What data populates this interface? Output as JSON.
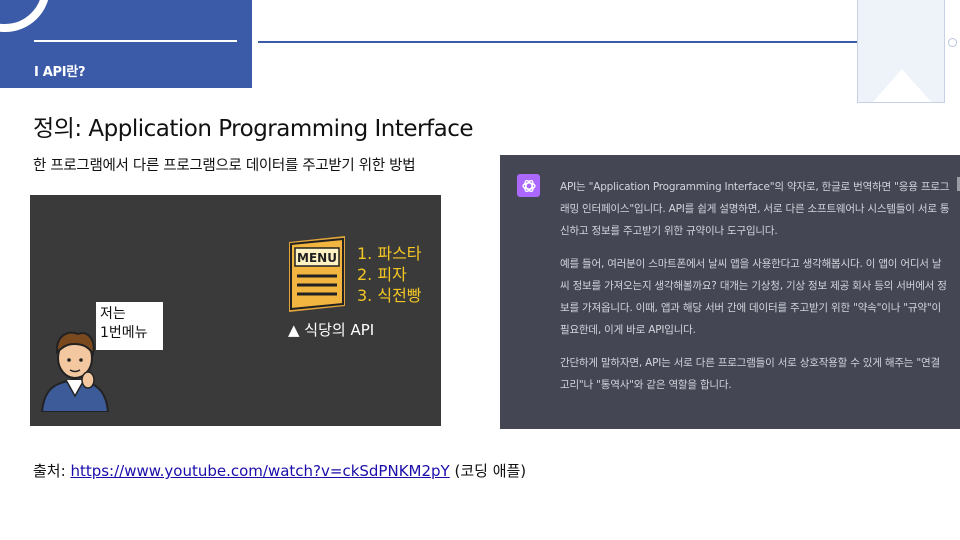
{
  "header": {
    "section_label": "I API란?"
  },
  "slide": {
    "title": "정의: Application Programming Interface",
    "subtitle": "한 프로그램에서 다른 프로그램으로 데이터를 주고받기 위한 방법"
  },
  "illustration": {
    "menu_sign": "MENU",
    "menu_items": [
      "1. 파스타",
      "2. 피자",
      "3. 식전빵"
    ],
    "caption": "▲ 식당의 API",
    "speech_lines": [
      "저는",
      "1번메뉴"
    ]
  },
  "chat": {
    "avatar_icon": "openai-logo-icon",
    "paragraphs": [
      "API는 \"Application Programming Interface\"의 약자로, 한글로 번역하면 \"응용 프로그래밍 인터페이스\"입니다. API를 쉽게 설명하면, 서로 다른 소프트웨어나 시스템들이 서로 통신하고 정보를 주고받기 위한 규약이나 도구입니다.",
      "예를 들어, 여러분이 스마트폰에서 날씨 앱을 사용한다고 생각해봅시다. 이 앱이 어디서 날씨 정보를 가져오는지 생각해볼까요? 대개는 기상청, 기상 정보 제공 회사 등의 서버에서 정보를 가져옵니다. 이때, 앱과 해당 서버 간에 데이터를 주고받기 위한 \"약속\"이나 \"규약\"이 필요한데, 이게 바로 API입니다.",
      "간단하게 말하자면, API는 서로 다른 프로그램들이 서로 상호작용할 수 있게 해주는 \"연결 고리\"나 \"통역사\"와 같은 역할을 합니다."
    ]
  },
  "source": {
    "label": "출처: ",
    "url": "https://www.youtube.com/watch?v=ckSdPNKM2pY",
    "suffix": " (코딩 애플)"
  },
  "colors": {
    "accent": "#3b5ba9",
    "menu_text": "#f3c623",
    "chat_bg": "#444654",
    "gpt_avatar": "#ab68ff"
  }
}
